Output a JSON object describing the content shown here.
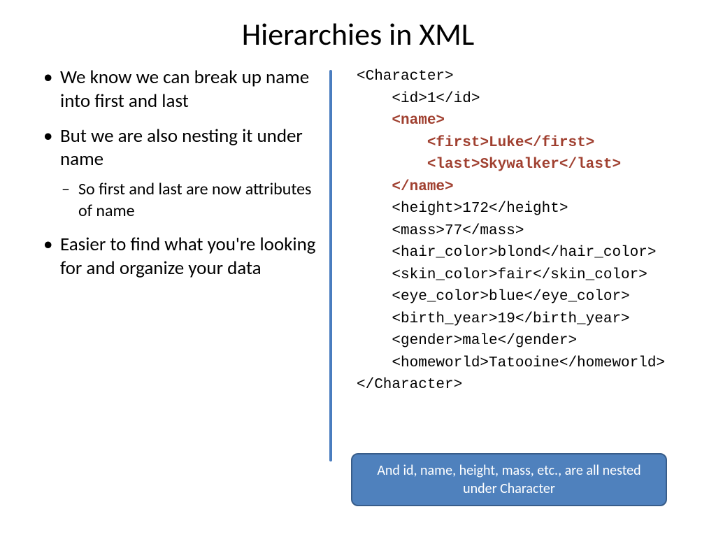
{
  "title": "Hierarchies in XML",
  "bullets": {
    "b1": "We know we can break up name into first and last",
    "b2": "But we are also nesting it under name",
    "b2_sub": "So first and last are now attributes of name",
    "b3": "Easier to find what you're looking for and organize your data"
  },
  "code": {
    "l01": "<Character>",
    "l02": "    <id>1</id>",
    "l03a": "    ",
    "l03b": "<name>",
    "l04a": "        ",
    "l04b": "<first>Luke</first>",
    "l05a": "        ",
    "l05b": "<last>Skywalker</last>",
    "l06a": "    ",
    "l06b": "</name>",
    "l07": "    <height>172</height>",
    "l08": "    <mass>77</mass>",
    "l09": "    <hair_color>blond</hair_color>",
    "l10": "    <skin_color>fair</skin_color>",
    "l11": "    <eye_color>blue</eye_color>",
    "l12": "    <birth_year>19</birth_year>",
    "l13": "    <gender>male</gender>",
    "l14": "    <homeworld>Tatooine</homeworld>",
    "l15": "</Character>"
  },
  "callout": "And id, name, height, mass, etc., are all nested under Character"
}
